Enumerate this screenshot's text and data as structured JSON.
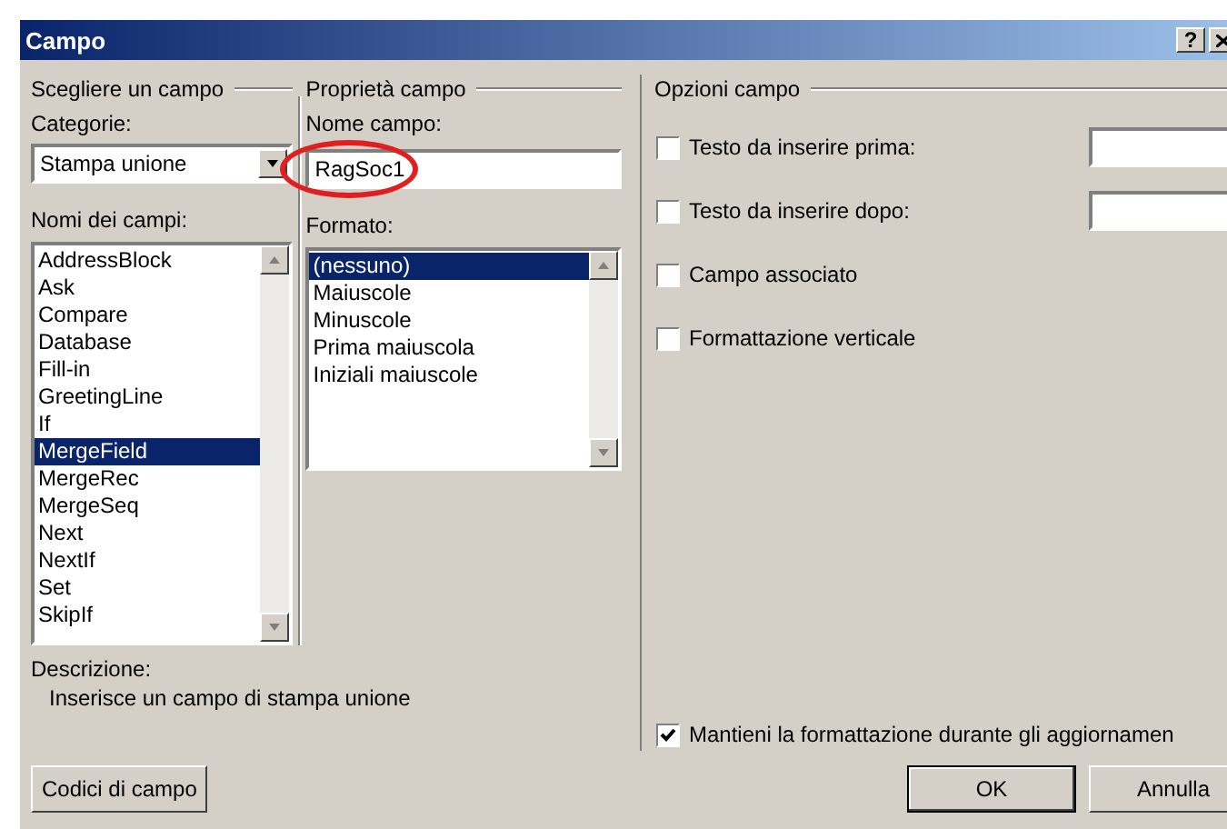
{
  "window": {
    "title": "Campo",
    "help_button": "?"
  },
  "choose_field": {
    "heading": "Scegliere un campo",
    "categories_label": "Categorie:",
    "category": "Stampa unione",
    "names_label": "Nomi dei campi:",
    "names": [
      {
        "label": "AddressBlock",
        "selected": false
      },
      {
        "label": "Ask",
        "selected": false
      },
      {
        "label": "Compare",
        "selected": false
      },
      {
        "label": "Database",
        "selected": false
      },
      {
        "label": "Fill-in",
        "selected": false
      },
      {
        "label": "GreetingLine",
        "selected": false
      },
      {
        "label": "If",
        "selected": false
      },
      {
        "label": "MergeField",
        "selected": true
      },
      {
        "label": "MergeRec",
        "selected": false
      },
      {
        "label": "MergeSeq",
        "selected": false
      },
      {
        "label": "Next",
        "selected": false
      },
      {
        "label": "NextIf",
        "selected": false
      },
      {
        "label": "Set",
        "selected": false
      },
      {
        "label": "SkipIf",
        "selected": false
      }
    ]
  },
  "field_properties": {
    "heading": "Proprietà campo",
    "name_label": "Nome campo:",
    "name_value": "RagSoc1",
    "name_circled": true,
    "format_label": "Formato:",
    "formats": [
      {
        "label": "(nessuno)",
        "selected": true
      },
      {
        "label": "Maiuscole",
        "selected": false
      },
      {
        "label": "Minuscole",
        "selected": false
      },
      {
        "label": "Prima maiuscola",
        "selected": false
      },
      {
        "label": "Iniziali maiuscole",
        "selected": false
      }
    ]
  },
  "field_options": {
    "heading": "Opzioni campo",
    "options": [
      {
        "label": "Testo da inserire prima:",
        "checked": false,
        "kind": "text"
      },
      {
        "label": "Testo da inserire dopo:",
        "checked": false,
        "kind": "text"
      },
      {
        "label": "Campo associato",
        "checked": false,
        "kind": "plain"
      },
      {
        "label": "Formattazione verticale",
        "checked": false,
        "kind": "plain"
      }
    ],
    "keep_formatting": {
      "label": "Mantieni la formattazione durante gli aggiornamen",
      "checked": true
    }
  },
  "description": {
    "label": "Descrizione:",
    "text": "Inserisce un campo di stampa unione"
  },
  "buttons": {
    "field_codes": "Codici di campo",
    "ok": "OK",
    "cancel": "Annulla"
  }
}
